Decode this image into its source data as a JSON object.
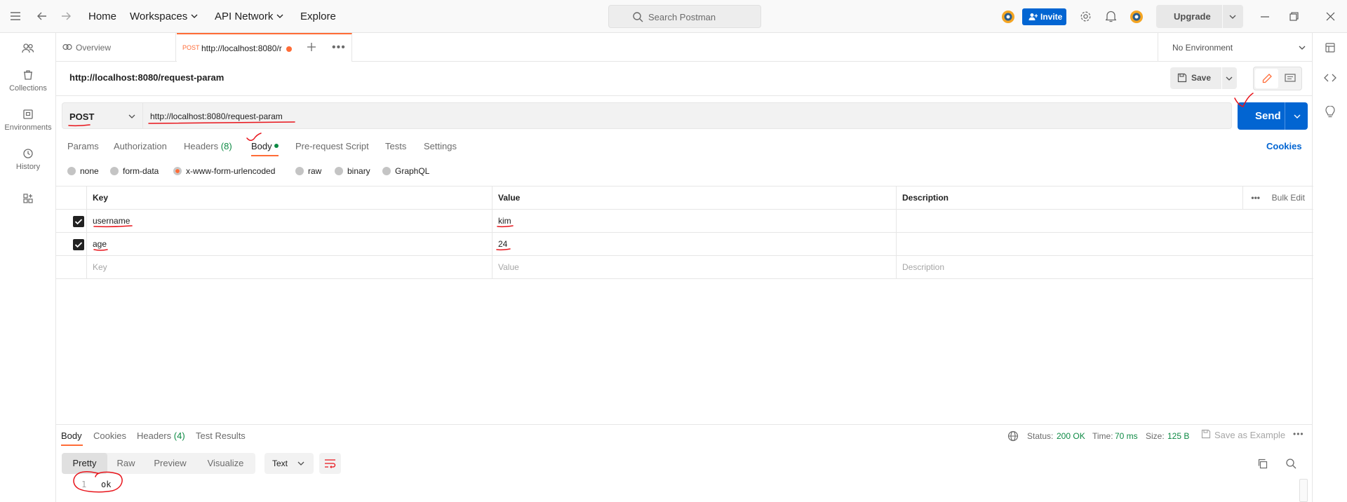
{
  "topbar": {
    "nav": [
      "Home",
      "Workspaces",
      "API Network",
      "Explore"
    ],
    "search_placeholder": "Search Postman",
    "invite_label": "Invite",
    "upgrade_label": "Upgrade"
  },
  "sidebar": {
    "items": [
      {
        "label": "",
        "icon": "team-icon"
      },
      {
        "label": "Collections",
        "icon": "trash-collections-icon"
      },
      {
        "label": "Environments",
        "icon": "environment-icon"
      },
      {
        "label": "History",
        "icon": "history-icon"
      },
      {
        "label": "",
        "icon": "apps-icon"
      }
    ]
  },
  "tabs": {
    "overview": "Overview",
    "active_method": "POST",
    "active_url": "http://localhost:8080/r",
    "environment": "No Environment"
  },
  "request": {
    "title": "http://localhost:8080/request-param",
    "save_label": "Save",
    "method": "POST",
    "url": "http://localhost:8080/request-param",
    "send_label": "Send",
    "subtabs": {
      "params": "Params",
      "authorization": "Authorization",
      "headers": "Headers",
      "headers_count": "(8)",
      "body": "Body",
      "prerequest": "Pre-request Script",
      "tests": "Tests",
      "settings": "Settings"
    },
    "cookies_label": "Cookies",
    "body_modes": [
      "none",
      "form-data",
      "x-www-form-urlencoded",
      "raw",
      "binary",
      "GraphQL"
    ],
    "selected_body_mode": "x-www-form-urlencoded"
  },
  "params_table": {
    "headers": {
      "key": "Key",
      "value": "Value",
      "description": "Description",
      "bulk_edit": "Bulk Edit"
    },
    "rows": [
      {
        "key": "username",
        "value": "kim",
        "description": "",
        "checked": true
      },
      {
        "key": "age",
        "value": "24",
        "description": "",
        "checked": true
      }
    ],
    "placeholders": {
      "key": "Key",
      "value": "Value",
      "description": "Description"
    }
  },
  "response": {
    "tabs": {
      "body": "Body",
      "cookies": "Cookies",
      "headers": "Headers",
      "headers_count": "(4)",
      "test_results": "Test Results"
    },
    "status_label": "Status:",
    "status_value": "200 OK",
    "time_label": "Time:",
    "time_value": "70 ms",
    "size_label": "Size:",
    "size_value": "125 B",
    "save_example": "Save as Example",
    "formats": [
      "Pretty",
      "Raw",
      "Preview",
      "Visualize"
    ],
    "selected_format": "Pretty",
    "language": "Text",
    "line_number": "1",
    "content": "ok"
  },
  "colors": {
    "accent": "#ff6c37",
    "primary_blue": "#0265d2",
    "success_green": "#0d8a44",
    "annotation_red": "#e8141b"
  }
}
